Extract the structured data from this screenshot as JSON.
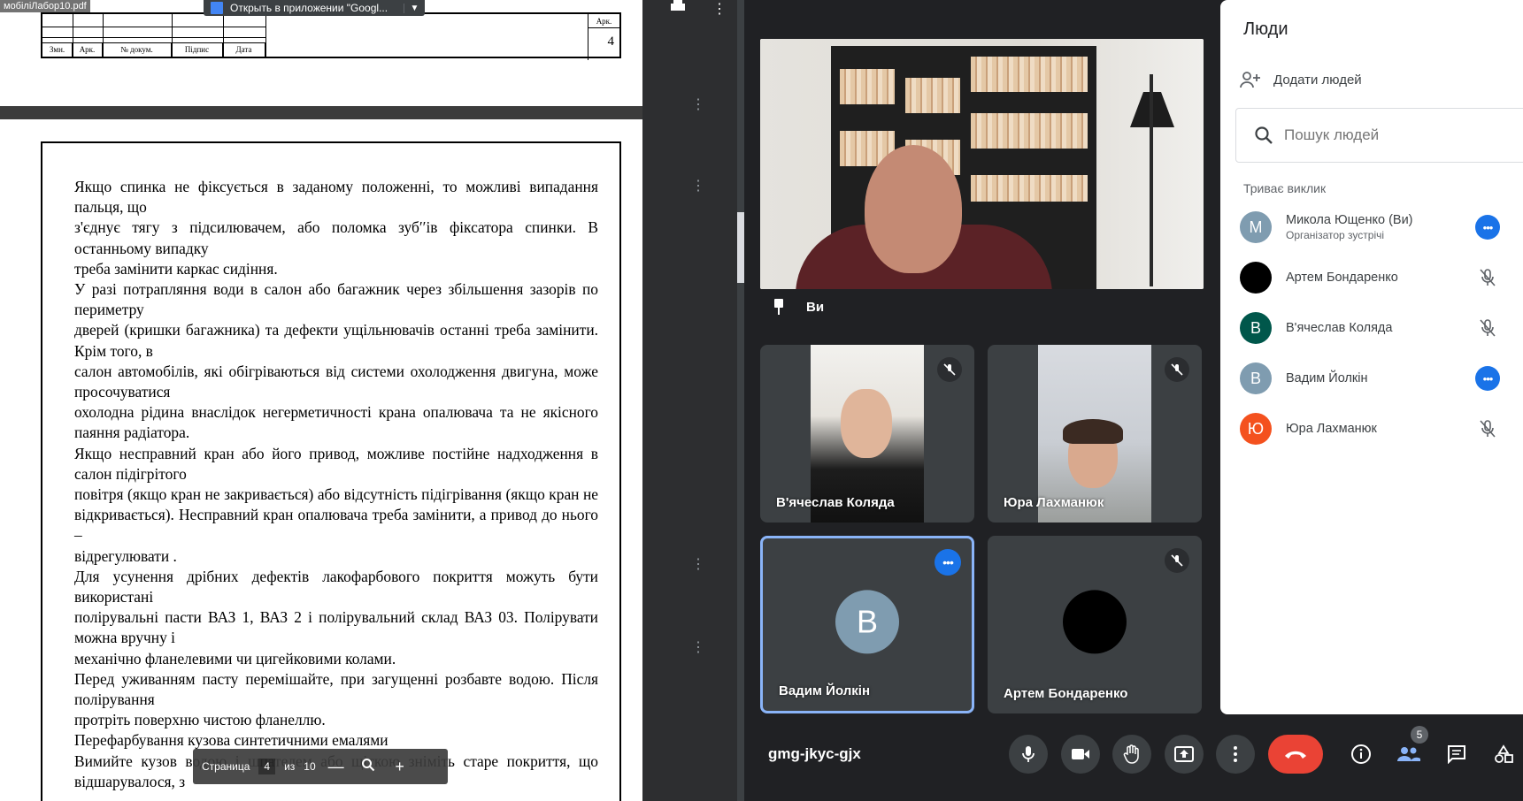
{
  "pdf": {
    "filename": "мобіліЛабор10.pdf",
    "open_in_app_label": "Открыть в приложении \"Googl...",
    "stamp": {
      "col_zmn": "Змн.",
      "col_ark": "Арк.",
      "col_doc": "№ докум.",
      "col_sign": "Підпис",
      "col_date": "Дата",
      "ark_label": "Арк.",
      "ark_num": "4"
    },
    "paragraphs": [
      "Якщо спинка не фіксується в заданому положенні, то можливі випадання пальця, що",
      "з'єднує тягу з підсилювачем, або поломка зуб′′ів фіксатора спинки. В останньому випадку",
      "треба замінити каркас сидіння.",
      "У разі потрапляння води в салон або багажник через збільшення зазорів по периметру",
      "дверей (кришки багажника) та дефекти ущільнювачів останні треба замінити. Крім того, в",
      "салон автомобілів, які обігріваються від системи охолодження двигуна, може просочуватися",
      "охолодна рідина внаслідок негерметичності крана опалювача та не якісного паяння радіатора.",
      "Якщо несправний кран або його привод, можливе постійне надходження в салон підігрітого",
      "повітря (якщо кран не закривається) або відсутність підігрівання (якщо кран не відкривається). Несправний кран опалювача треба замінити, а привод до нього –",
      "відрегулювати .",
      "Для усунення дрібних дефектів лакофарбового покриття можуть бути використані",
      "полірувальні пасти ВАЗ 1, ВАЗ 2 і полірувальний склад ВАЗ 03. Полірувати можна вручну і",
      "механічно фланелевими чи цигейковими колами.",
      "Перед уживанням пасту перемішайте, при загущенні розбавте водою. Після полірування",
      "протріть поверхню чистою фланеллю.",
      "Перефарбування кузова синтетичними емалями",
      "Вимийте кузов водою і шпателем або щіткою зніміть старе покриття, що відшарувалося, з"
    ],
    "toolbar": {
      "page_label": "Страница",
      "current_page": "4",
      "of_label": "из",
      "total_pages": "10",
      "minus": "—",
      "plus": "+"
    }
  },
  "meet": {
    "self_label": "Ви",
    "meeting_code": "gmg-jkyc-gjx",
    "participants_count": "5",
    "tiles": [
      {
        "name": "В'ячеслав Коляда"
      },
      {
        "name": "Юра Лахманюк"
      },
      {
        "name": "Вадим Йолкін",
        "initial": "В",
        "avatar_color": "#7f9cb0"
      },
      {
        "name": "Артем Бондаренко",
        "avatar_color": "#000000"
      }
    ],
    "end_call_color": "#ea4335"
  },
  "people": {
    "title": "Люди",
    "add_people": "Додати людей",
    "search_placeholder": "Пошук людей",
    "section_label": "Триває виклик",
    "list": [
      {
        "initial": "М",
        "name": "Микола Ющенко (Ви)",
        "sub": "Організатор зустрічі",
        "color": "#7f9cb0",
        "action": "more"
      },
      {
        "initial": "",
        "name": "Артем Бондаренко",
        "sub": "",
        "color": "#000000",
        "action": "mic-off"
      },
      {
        "initial": "В",
        "name": "В'ячеслав Коляда",
        "sub": "",
        "color": "#00574b",
        "action": "mic-off"
      },
      {
        "initial": "В",
        "name": "Вадим Йолкін",
        "sub": "",
        "color": "#7f9cb0",
        "action": "more"
      },
      {
        "initial": "Ю",
        "name": "Юра Лахманюк",
        "sub": "",
        "color": "#f4511e",
        "action": "mic-off"
      }
    ]
  }
}
